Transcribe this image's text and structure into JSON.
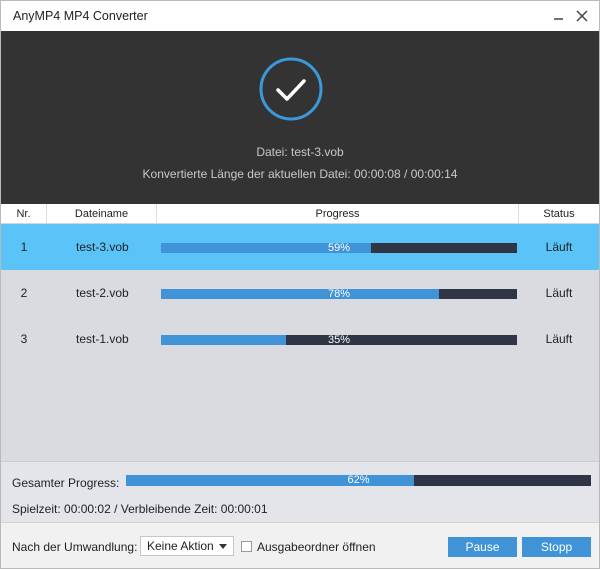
{
  "window": {
    "title": "AnyMP4 MP4 Converter"
  },
  "header": {
    "file_line": "Datei: test-3.vob",
    "length_line": "Konvertierte Länge der aktuellen Datei: 00:00:08 / 00:00:14",
    "status_icon": "checkmark-circle-icon"
  },
  "table": {
    "columns": [
      "Nr.",
      "Dateiname",
      "Progress",
      "Status"
    ],
    "rows": [
      {
        "nr": "1",
        "name": "test-3.vob",
        "progress": 59,
        "progress_label": "59%",
        "status": "Läuft",
        "selected": true
      },
      {
        "nr": "2",
        "name": "test-2.vob",
        "progress": 78,
        "progress_label": "78%",
        "status": "Läuft",
        "selected": false
      },
      {
        "nr": "3",
        "name": "test-1.vob",
        "progress": 35,
        "progress_label": "35%",
        "status": "Läuft",
        "selected": false
      }
    ]
  },
  "summary": {
    "total_label": "Gesamter Progress:",
    "total_progress": 62,
    "total_progress_label": "62%",
    "time_line": "Spielzeit: 00:00:02 / Verbleibende Zeit: 00:00:01"
  },
  "footer": {
    "after_label": "Nach der Umwandlung:",
    "after_select_value": "Keine Aktion",
    "open_folder_label": "Ausgabeordner öffnen",
    "open_folder_checked": false,
    "pause_label": "Pause",
    "stop_label": "Stopp"
  },
  "colors": {
    "accent": "#3f93d6",
    "selected_row": "#5ac3f8",
    "header_bg": "#333333",
    "bar_track": "#2f3545"
  }
}
